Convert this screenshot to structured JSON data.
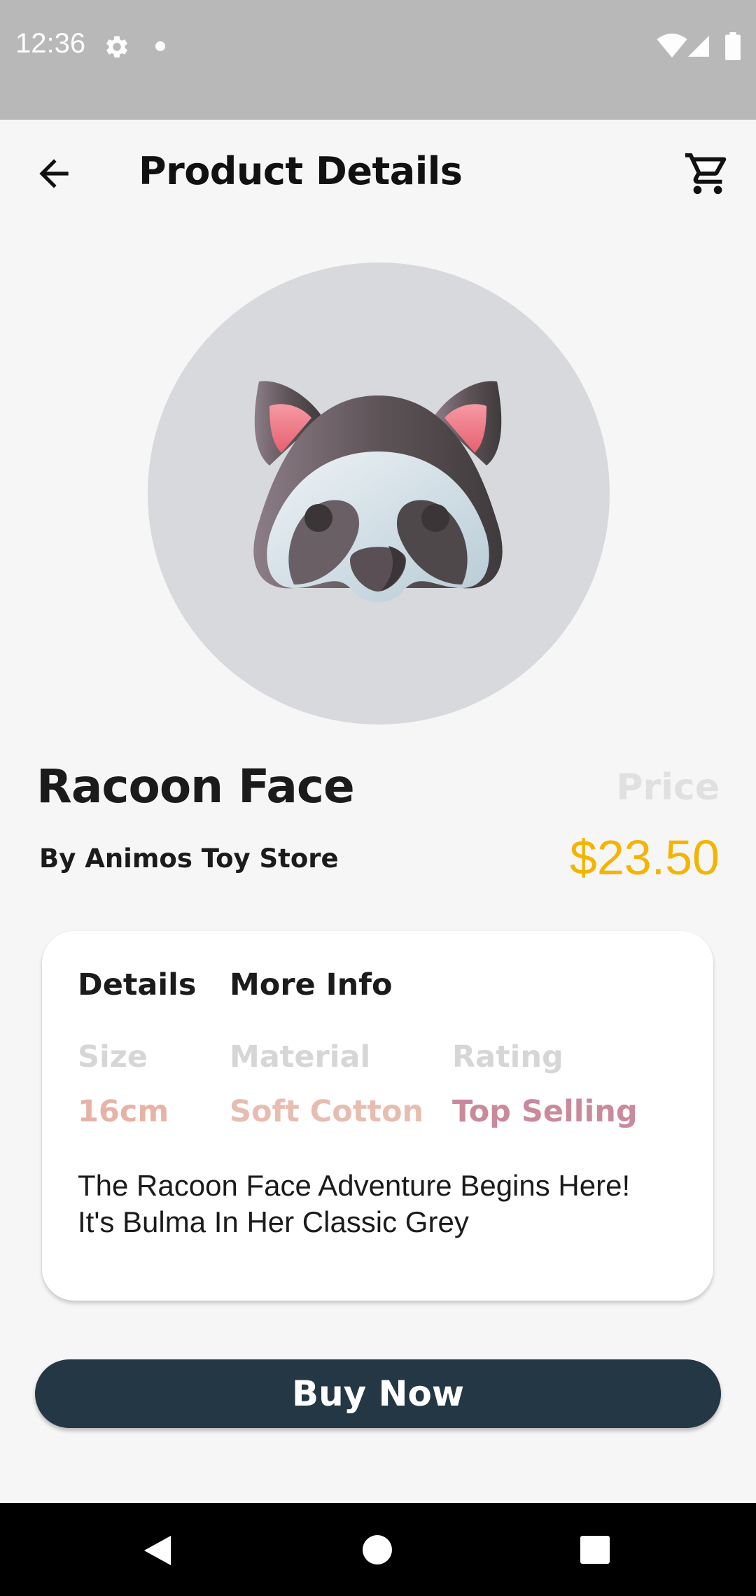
{
  "status_bar": {
    "time": "12:36",
    "icons": [
      "gear-icon",
      "dot-icon",
      "wifi-icon",
      "signal-icon",
      "battery-icon"
    ]
  },
  "app_bar": {
    "title": "Product Details",
    "back_icon": "arrow-back-icon",
    "cart_icon": "shopping-cart-icon"
  },
  "product": {
    "name": "Racoon Face",
    "store": "By Animos Toy Store",
    "price_label": "Price",
    "price": "$23.50",
    "image_icon": "raccoon-face-icon"
  },
  "details_card": {
    "tabs": [
      "Details",
      "More Info"
    ],
    "attributes": [
      {
        "label": "Size",
        "value": "16cm",
        "color": "#e6b3a6"
      },
      {
        "label": "Material",
        "value": "Soft Cotton",
        "color": "#e7bdb1"
      },
      {
        "label": "Rating",
        "value": "Top Selling",
        "color": "#c98a9b"
      }
    ],
    "description_lines": [
      "The Racoon Face Adventure Begins Here!",
      "It's Bulma In Her Classic Grey"
    ]
  },
  "buy_button": {
    "label": "Buy Now"
  },
  "colors": {
    "accent_price": "#f4b400",
    "button_bg": "#233744",
    "status_bar_bg": "#b8b8b8"
  }
}
